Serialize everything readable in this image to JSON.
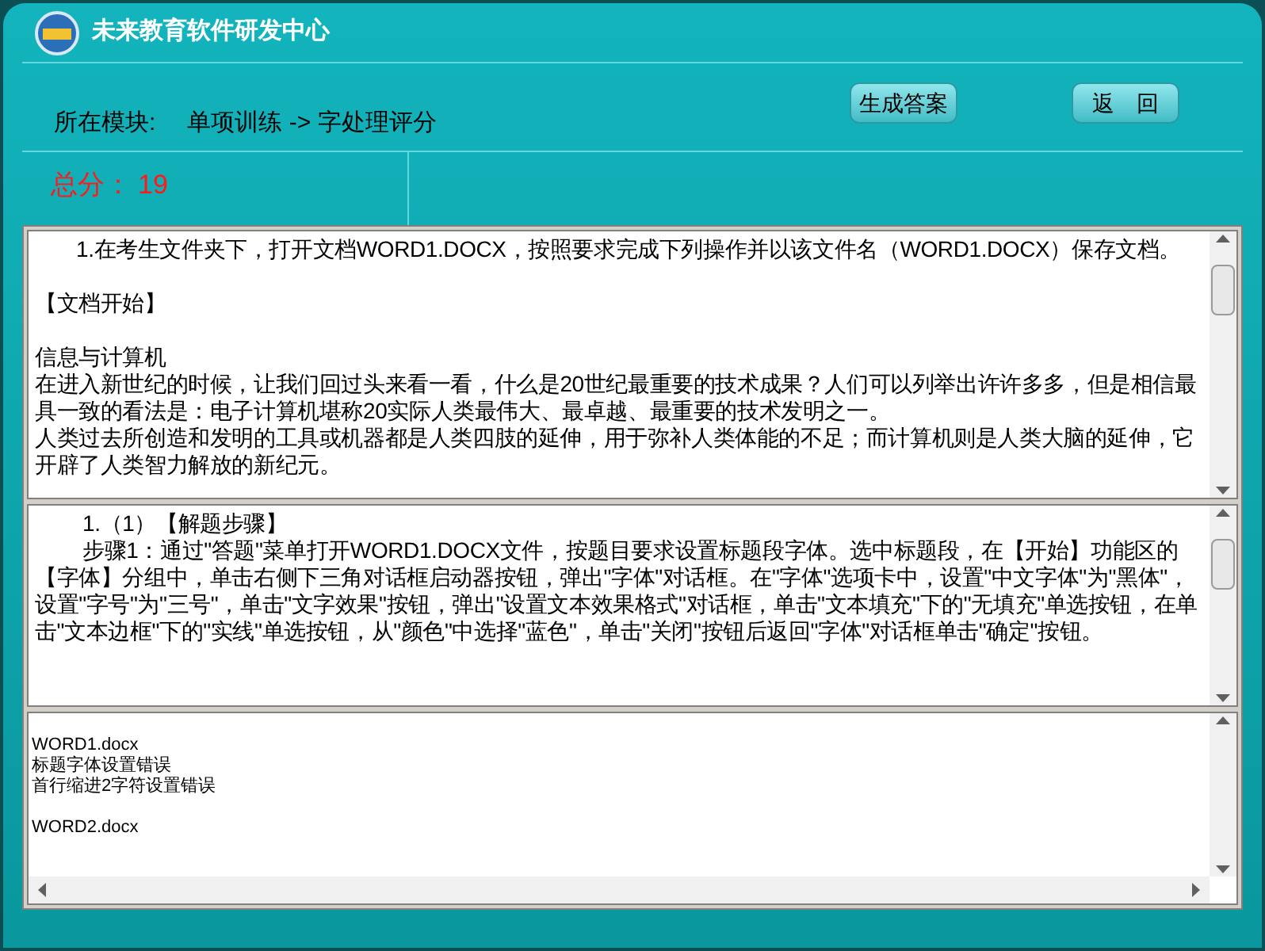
{
  "window": {
    "title": "未来教育软件研发中心"
  },
  "module": {
    "label": "所在模块:",
    "path": "单项训练 -> 字处理评分"
  },
  "buttons": [
    "生成答案",
    "返　回"
  ],
  "score": {
    "label": "总分：",
    "value": "19"
  },
  "question_panel": {
    "title_line": "1.在考生文件夹下，打开文档WORD1.DOCX，按照要求完成下列操作并以该文件名（WORD1.DOCX）保存文档。",
    "blocks": [
      {
        "lines": [
          "【文档开始】"
        ]
      },
      {
        "lines": [
          "信息与计算机",
          "在进入新世纪的时候，让我们回过头来看一看，什么是20世纪最重要的技术成果？人们可以列举出许许多多，但是相信最具一致的看法是：电子计算机堪称20实际人类最伟大、最卓越、最重要的技术发明之一。",
          "人类过去所创造和发明的工具或机器都是人类四肢的延伸，用于弥补人类体能的不足；而计算机则是人类大脑的延伸，它开辟了人类智力解放的新纪元。"
        ]
      }
    ]
  },
  "steps_panel": {
    "heading": "1.（1）【解题步骤】",
    "steps": [
      "步骤1：通过\"答题\"菜单打开WORD1.DOCX文件，按题目要求设置标题段字体。选中标题段，在【开始】功能区的【字体】分组中，单击右侧下三角对话框启动器按钮，弹出\"字体\"对话框。在\"字体\"选项卡中，设置\"中文字体\"为\"黑体\"，设置\"字号\"为\"三号\"，单击\"文字效果\"按钮，弹出\"设置文本效果格式\"对话框，单击\"文本填充\"下的\"无填充\"单选按钮，在单击\"文本边框\"下的\"实线\"单选按钮，从\"颜色\"中选择\"蓝色\"，单击\"关闭\"按钮后返回\"字体\"对话框单击\"确定\"按钮。"
    ]
  },
  "results_panel": {
    "files": [
      {
        "file": "WORD1.docx",
        "errors": [
          "标题字体设置错误",
          "首行缩进2字符设置错误"
        ]
      },
      {
        "file": "WORD2.docx"
      }
    ]
  }
}
